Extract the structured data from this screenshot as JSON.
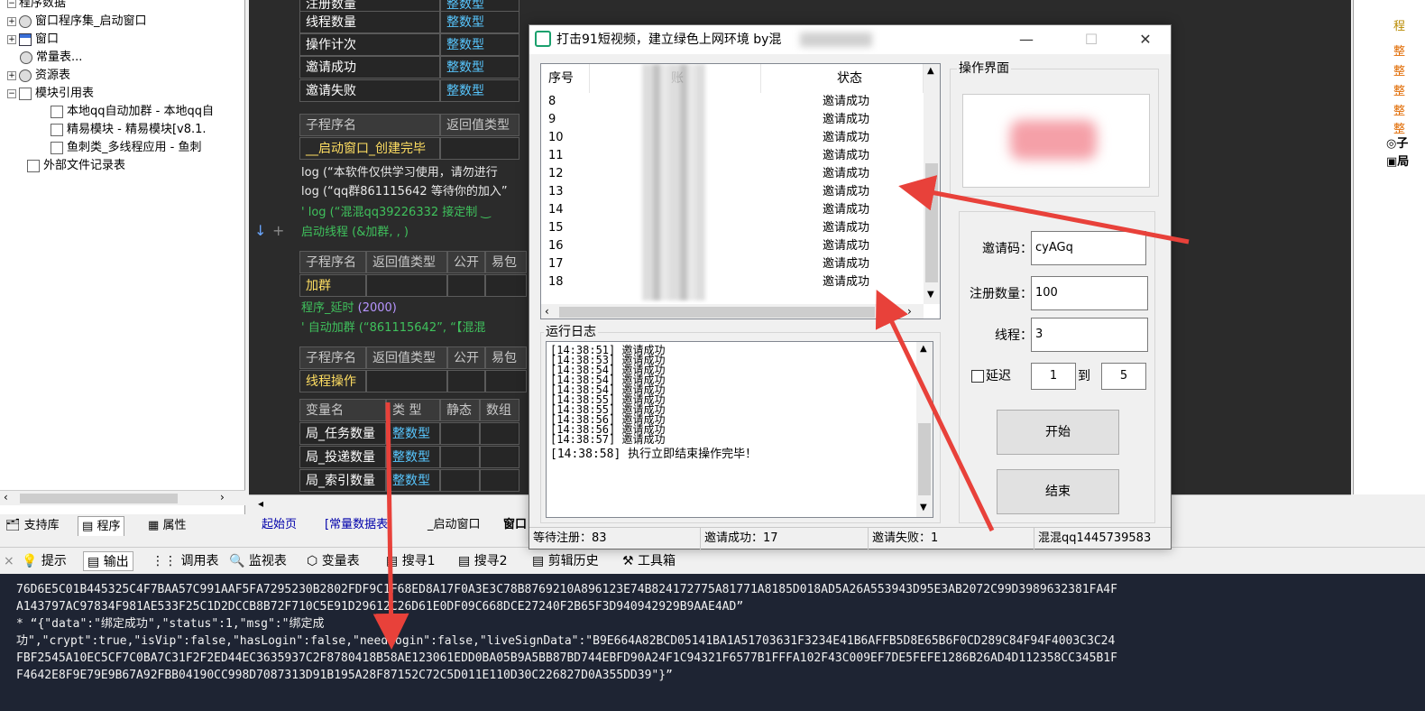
{
  "tree": {
    "items": [
      {
        "label": "程序数据"
      },
      {
        "label": "窗口程序集_启动窗口"
      },
      {
        "label": "窗口"
      },
      {
        "label": "常量表..."
      },
      {
        "label": "资源表"
      },
      {
        "label": "模块引用表"
      },
      {
        "label": "本地qq自动加群 - 本地qq自"
      },
      {
        "label": "精易模块 - 精易模块[v8.1."
      },
      {
        "label": "鱼刺类_多线程应用 - 鱼刺"
      },
      {
        "label": "外部文件记录表"
      }
    ],
    "tabs": [
      "支持库",
      "程序",
      "属性"
    ]
  },
  "editor": {
    "top_table": [
      {
        "name": "注册数量",
        "type": "整数型"
      },
      {
        "name": "线程数量",
        "type": "整数型"
      },
      {
        "name": "操作计次",
        "type": "整数型"
      },
      {
        "name": "邀请成功",
        "type": "整数型"
      },
      {
        "name": "邀请失败",
        "type": "整数型"
      }
    ],
    "sub_headers": [
      "子程序名",
      "返回值类型",
      "公开",
      "易包"
    ],
    "sub1": "__启动窗口_创建完毕",
    "lines": [
      "log (“本软件仅供学习使用，请勿进行",
      "log (“qq群861115642 等待你的加入”",
      "' log (“混混qq39226332   接定制 ‿"
    ],
    "thread_line": "启动线程 (&加群, , )",
    "sub2": "加群",
    "delay_fn": "程序_延时",
    "delay_val": "(2000)",
    "comment2": "' 自动加群 (“861115642”, “【混混",
    "sub3": "线程操作",
    "var_headers": [
      "变量名",
      "类 型",
      "静态",
      "数组"
    ],
    "vars": [
      {
        "name": "局_任务数量",
        "type": "整数型"
      },
      {
        "name": "局_投递数量",
        "type": "整数型"
      },
      {
        "name": "局_索引数量",
        "type": "整数型"
      }
    ],
    "tabs": [
      "起始页",
      "[常量数据表]",
      "_启动窗口",
      "窗口"
    ]
  },
  "right_strip": [
    "程",
    "整",
    "整",
    "整",
    "整",
    "整",
    "子",
    "局"
  ],
  "output": {
    "tabs": [
      "提示",
      "输出",
      "调用表",
      "监视表",
      "变量表",
      "搜寻1",
      "搜寻2",
      "剪辑历史",
      "工具箱"
    ],
    "lines": [
      "76D6E5C01B445325C4F7BAA57C991AAF5FA7295230B2802FDF9C1F68ED8A17F0A3E3C78B8769210A896123E74B824172775A81771A8185D018AD5A26A553943D95E3AB2072C99D3989632381FA4F",
      "A143797AC97834F981AE533F25C1D2DCCB8B72F710C5E91D29612C26D61E0DF09C668DCE27240F2B65F3D940942929B9AAE4AD”",
      "*  “{\"data\":\"绑定成功\",\"status\":1,\"msg\":\"绑定成",
      "功\",\"crypt\":true,\"isVip\":false,\"hasLogin\":false,\"needLogin\":false,\"liveSignData\":\"B9E664A82BCD05141BA1A51703631F3234E41B6AFFB5D8E65B6F0CD289C84F94F4003C3C24",
      "FBF2545A10EC5CF7C0BA7C31F2F2ED44EC3635937C2F8780418B58AE123061EDD0BA05B9A5BB87BD744EBFD90A24F1C94321F6577B1FFFA102F43C009EF7DE5FEFE1286B26AD4D112358CC345B1F",
      "F4642E8F9E79E9B67A92FBB04190CC998D7087313D91B195A28F87152C72C5D011E110D30C226827D0A355DD39\"}”"
    ]
  },
  "window": {
    "title": "打击91短视频，建立绿色上网环境   by混",
    "buttons": {
      "min": "—",
      "max": "☐",
      "close": "✕"
    },
    "list": {
      "columns": [
        "序号",
        "账",
        "状态"
      ],
      "rows": [
        {
          "n": "8",
          "s": "邀请成功"
        },
        {
          "n": "9",
          "s": "邀请成功"
        },
        {
          "n": "10",
          "s": "邀请成功"
        },
        {
          "n": "11",
          "s": "邀请成功"
        },
        {
          "n": "12",
          "s": "邀请成功"
        },
        {
          "n": "13",
          "s": "邀请成功"
        },
        {
          "n": "14",
          "s": "邀请成功"
        },
        {
          "n": "15",
          "s": "邀请成功"
        },
        {
          "n": "16",
          "s": "邀请成功"
        },
        {
          "n": "17",
          "s": "邀请成功"
        },
        {
          "n": "18",
          "s": "邀请成功"
        }
      ]
    },
    "log_label": "运行日志",
    "log": [
      "[14:38:51] 邀请成功",
      "[14:38:53] 邀请成功",
      "[14:38:54] 邀请成功",
      "[14:38:54] 邀请成功",
      "[14:38:54] 邀请成功",
      "[14:38:55] 邀请成功",
      "[14:38:55] 邀请成功",
      "[14:38:56] 邀请成功",
      "[14:38:56] 邀请成功",
      "[14:38:57] 邀请成功",
      "[14:38:58] 执行立即结束操作完毕！"
    ],
    "ops_label": "操作界面",
    "form": {
      "invite_label": "邀请码：",
      "invite_value": "cyAGq",
      "count_label": "注册数量：",
      "count_value": "100",
      "thread_label": "线程：",
      "thread_value": "3",
      "delay_label": "延迟",
      "delay_from": "1",
      "to_label": "到",
      "delay_to": "5",
      "start": "开始",
      "stop": "结束"
    },
    "status": {
      "pending": "等待注册：83",
      "success": "邀请成功：17",
      "fail": "邀请失败：1",
      "author": "混混qq1445739583"
    }
  },
  "colors": {
    "arrow": "#e8413a",
    "editor_bg": "#2b2b2b",
    "output_bg": "#1e2433"
  }
}
